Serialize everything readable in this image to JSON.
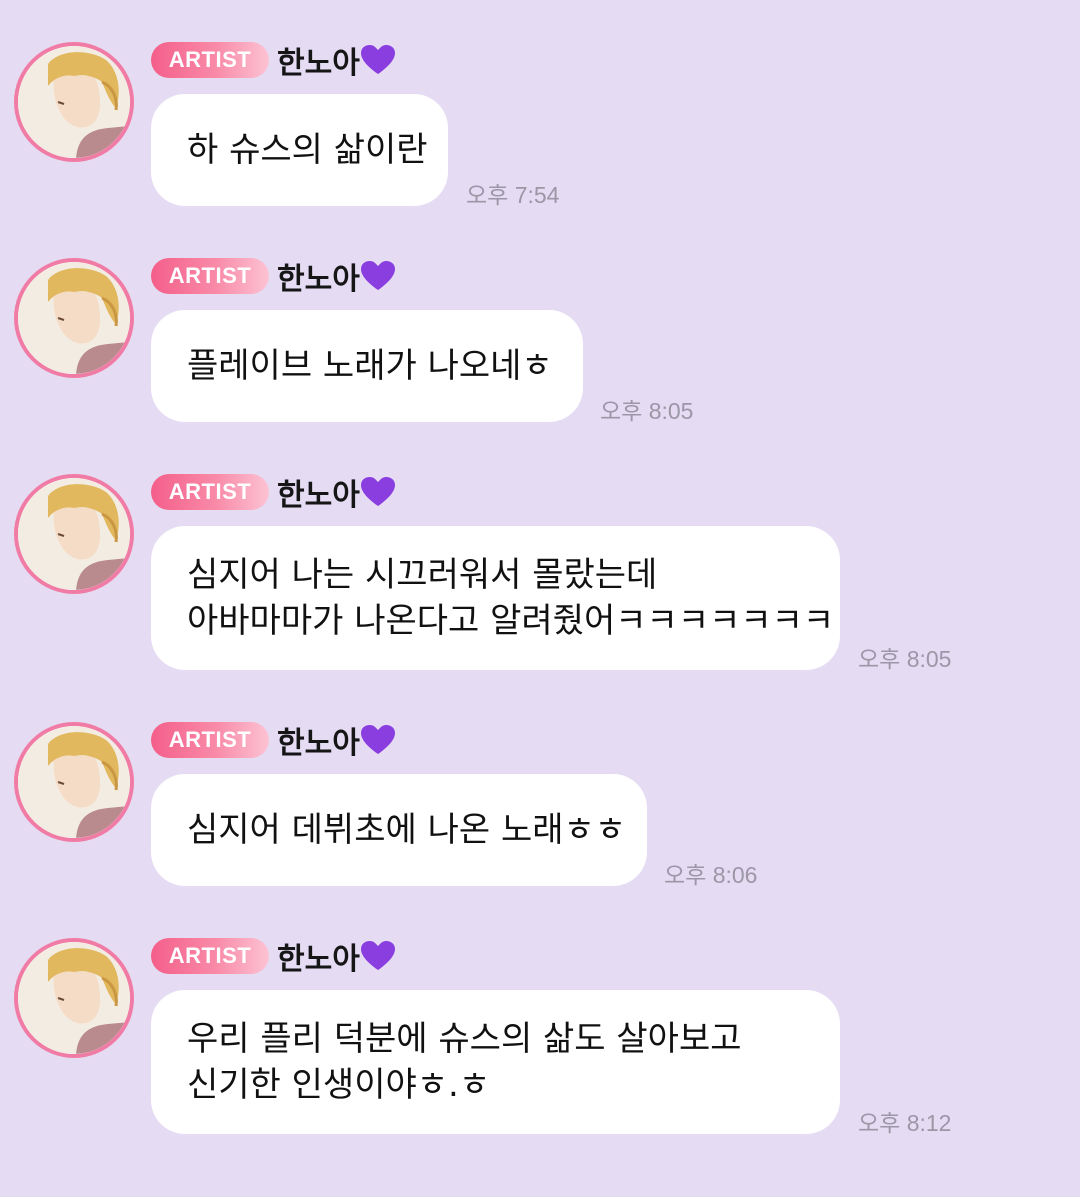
{
  "sender": {
    "badge": "ARTIST",
    "name": "한노아"
  },
  "messages": [
    {
      "lines": [
        "하 슈스의 삶이란"
      ],
      "time": "오후 7:54"
    },
    {
      "lines": [
        "플레이브 노래가 나오네ㅎ"
      ],
      "time": "오후 8:05"
    },
    {
      "lines": [
        "심지어 나는 시끄러워서 몰랐는데",
        "아바마마가 나온다고 알려줬어ㅋㅋㅋㅋㅋㅋㅋ"
      ],
      "time": "오후 8:05"
    },
    {
      "lines": [
        "심지어 데뷔초에 나온 노래ㅎㅎ"
      ],
      "time": "오후 8:06"
    },
    {
      "lines": [
        "우리 플리 덕분에 슈스의 삶도 살아보고",
        "신기한 인생이야ㅎ.ㅎ"
      ],
      "time": "오후 8:12"
    }
  ],
  "colors": {
    "background": "#e5dbf3",
    "bubble": "#ffffff",
    "badge": "#f45f8a",
    "heart": "#8a3ee0",
    "avatar_ring": "#f07ca6",
    "time_text": "#9c97a6"
  },
  "icons": [
    "purple-heart-icon",
    "avatar-image"
  ]
}
